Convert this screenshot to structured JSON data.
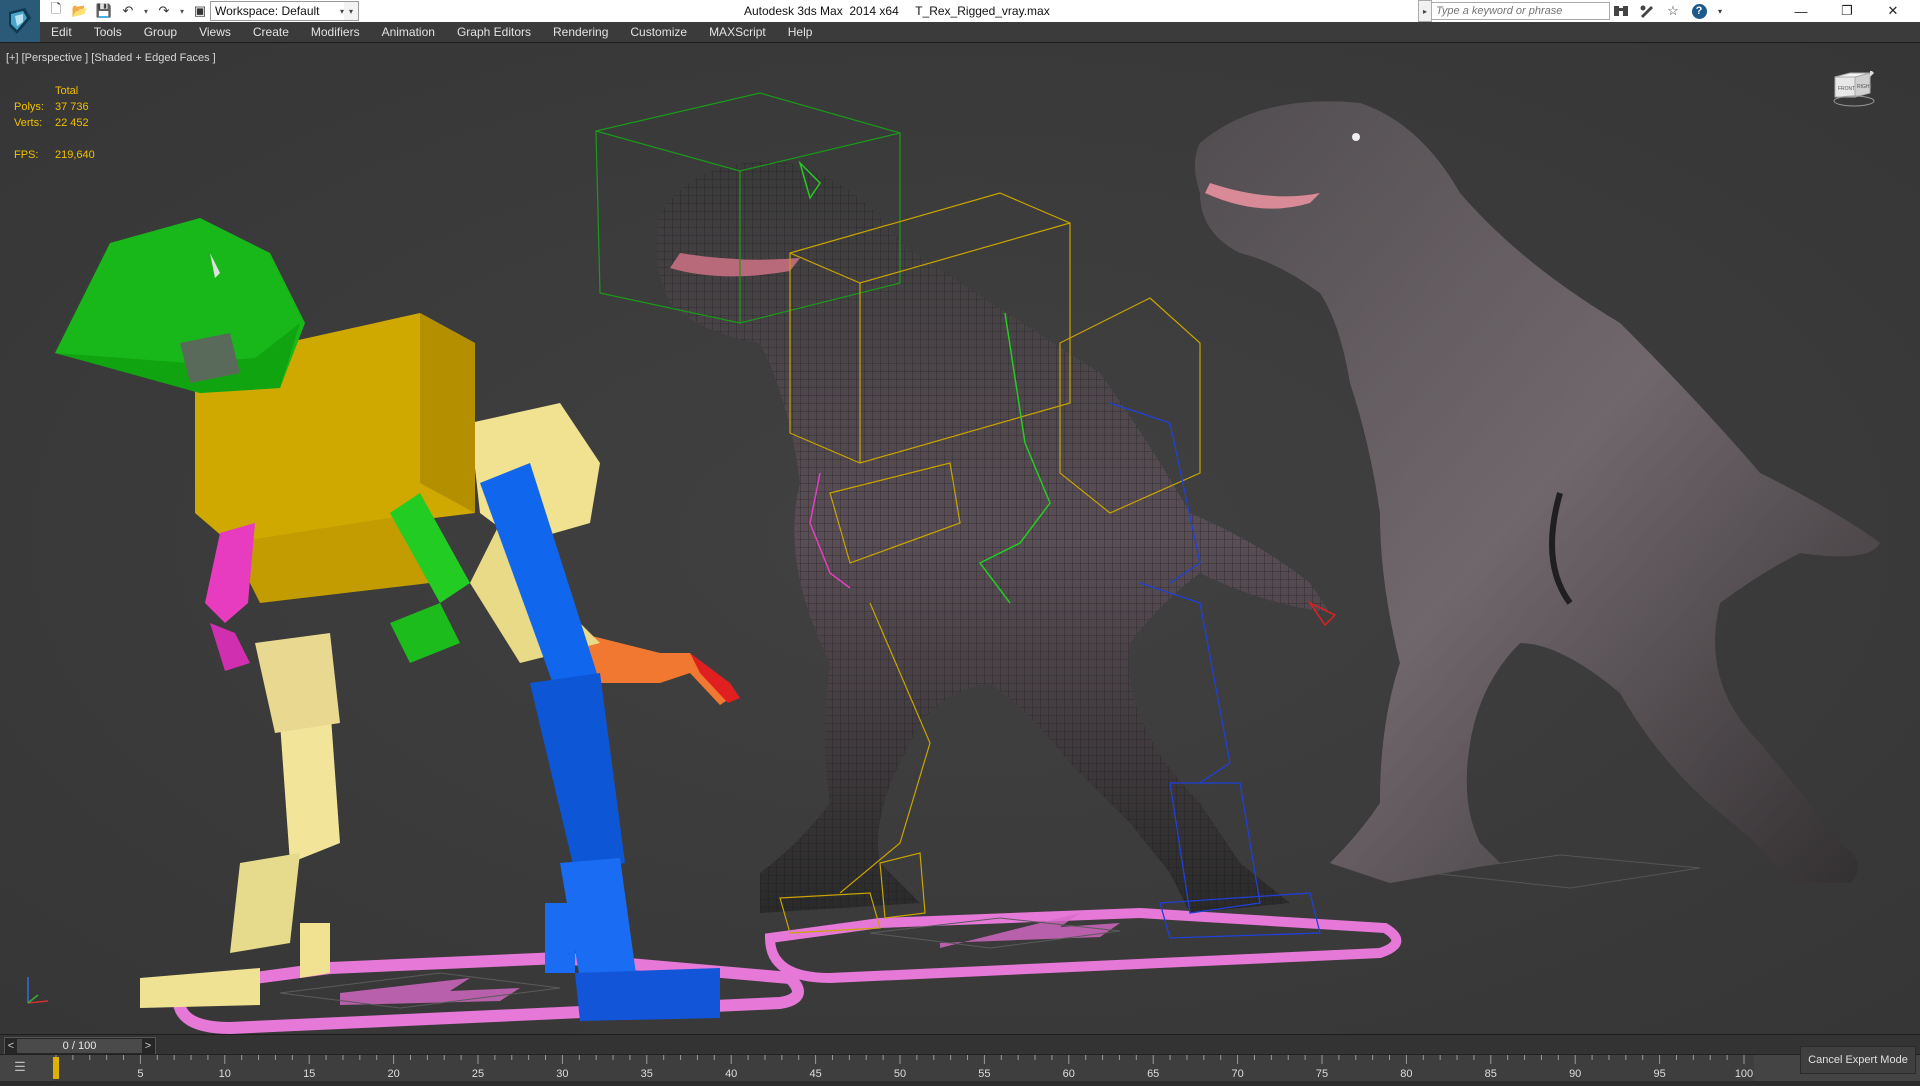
{
  "window": {
    "title": "Autodesk 3ds Max  2014 x64     T_Rex_Rigged_vray.max"
  },
  "workspace": {
    "label": "Workspace: Default"
  },
  "search": {
    "placeholder": "Type a keyword or phrase"
  },
  "menu": {
    "items": [
      {
        "label": "Edit"
      },
      {
        "label": "Tools"
      },
      {
        "label": "Group"
      },
      {
        "label": "Views"
      },
      {
        "label": "Create"
      },
      {
        "label": "Modifiers"
      },
      {
        "label": "Animation"
      },
      {
        "label": "Graph Editors"
      },
      {
        "label": "Rendering"
      },
      {
        "label": "Customize"
      },
      {
        "label": "MAXScript"
      },
      {
        "label": "Help"
      }
    ]
  },
  "viewport": {
    "label": "[+] [Perspective ] [Shaded + Edged Faces ]",
    "stats": {
      "header": "Total",
      "polys_label": "Polys:",
      "polys_value": "37 736",
      "verts_label": "Verts:",
      "verts_value": "22 452",
      "fps_label": "FPS:",
      "fps_value": "219,640"
    },
    "viewcube": {
      "front": "FRONT",
      "right": "RIGHT"
    }
  },
  "timeline": {
    "frame_display": "0 / 100",
    "prev": "<",
    "next": ">",
    "ticks": [
      "5",
      "10",
      "15",
      "20",
      "25",
      "30",
      "35",
      "40",
      "45",
      "50",
      "55",
      "60",
      "65",
      "70",
      "75",
      "80",
      "85",
      "90",
      "95",
      "100"
    ],
    "current_frame": 0,
    "total_frames": 100
  },
  "status": {
    "cancel_expert": "Cancel Expert Mode"
  },
  "colors": {
    "accent_yellow": "#e0b000",
    "viewport_bg": "#3c3c3c",
    "stats_text": "#f0c000",
    "bone_green": "#1fbf1f",
    "bone_yellow": "#d2b000",
    "bone_blue": "#1060e0",
    "bone_pink": "#e040c0",
    "bone_orange": "#f08030"
  }
}
